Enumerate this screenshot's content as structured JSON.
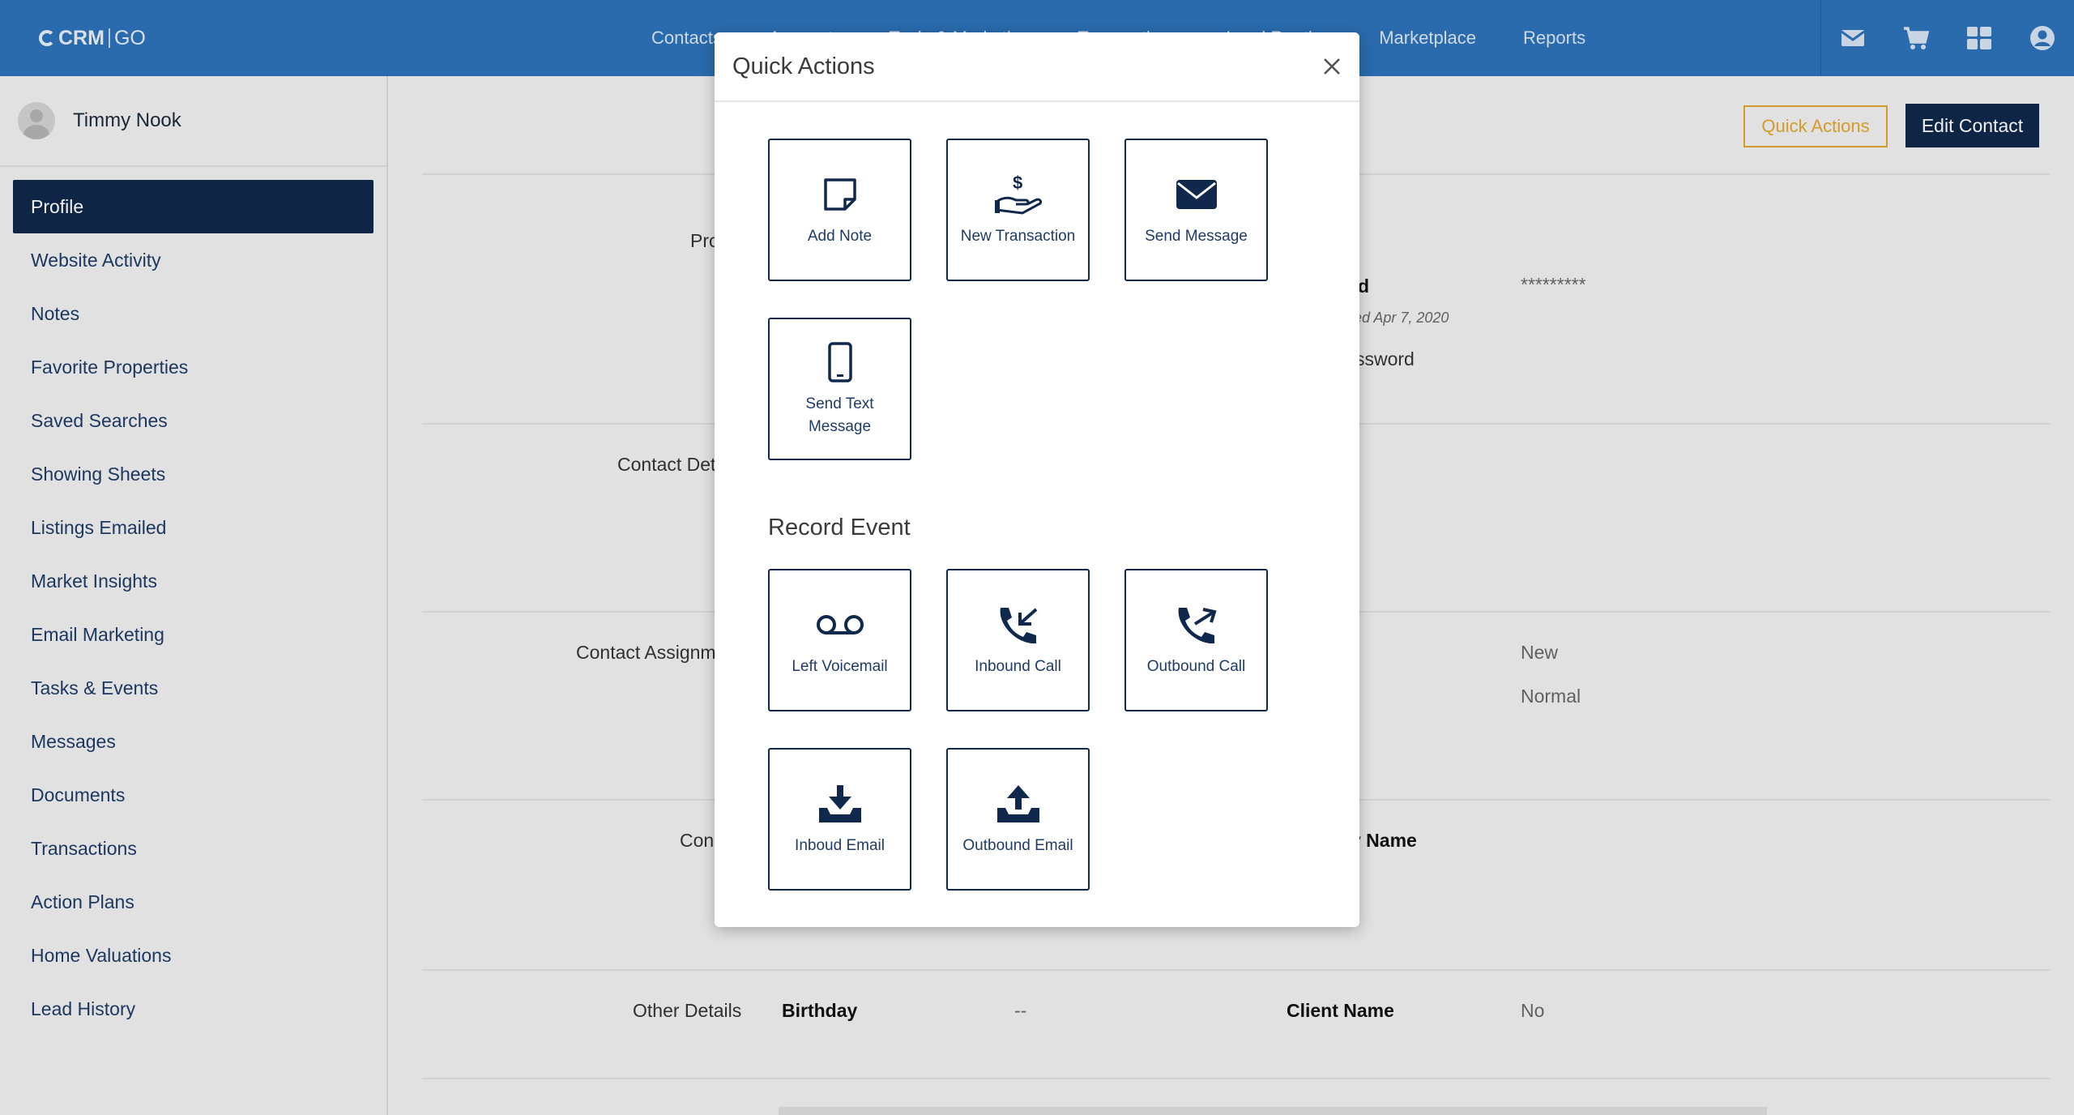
{
  "app": {
    "logo_left": "CRM",
    "logo_right": "GO"
  },
  "topnav": {
    "items": [
      "Contacts",
      "Accounts",
      "Tools & Marketing",
      "Transactions",
      "Lead Routing",
      "Marketplace",
      "Reports"
    ]
  },
  "sidebar": {
    "user_name": "Timmy Nook",
    "items": [
      {
        "label": "Profile"
      },
      {
        "label": "Website Activity"
      },
      {
        "label": "Notes"
      },
      {
        "label": "Favorite Properties"
      },
      {
        "label": "Saved Searches"
      },
      {
        "label": "Showing Sheets"
      },
      {
        "label": "Listings Emailed"
      },
      {
        "label": "Market Insights"
      },
      {
        "label": "Email Marketing"
      },
      {
        "label": "Tasks & Events"
      },
      {
        "label": "Messages"
      },
      {
        "label": "Documents"
      },
      {
        "label": "Transactions"
      },
      {
        "label": "Action Plans"
      },
      {
        "label": "Home Valuations"
      },
      {
        "label": "Lead History"
      }
    ]
  },
  "header_buttons": {
    "quick_actions": "Quick Actions",
    "edit_contact": "Edit Contact"
  },
  "profile": {
    "section_profile": "Pro",
    "password_label": "d",
    "password_value": "*********",
    "password_updated": "ed Apr 7, 2020",
    "password_link": "ssword",
    "section_contact_details": "Contact Det",
    "section_contact_assignment": "Contact Assignm",
    "status_value": "New",
    "priority_value": "Normal",
    "section_con": "Con",
    "company_name_label": "y Name",
    "section_other": "Other Details",
    "birthday_label": "Birthday",
    "birthday_value": "--",
    "client_name_label": "Client Name",
    "client_name_value": "No"
  },
  "modal": {
    "title": "Quick Actions",
    "actions": [
      {
        "label": "Add Note",
        "icon": "note-icon"
      },
      {
        "label": "New Transaction",
        "icon": "transaction-icon"
      },
      {
        "label": "Send Message",
        "icon": "envelope-icon"
      },
      {
        "label": "Send Text Message",
        "icon": "mobile-icon"
      }
    ],
    "record_title": "Record Event",
    "events": [
      {
        "label": "Left Voicemail",
        "icon": "voicemail-icon"
      },
      {
        "label": "Inbound Call",
        "icon": "inbound-call-icon"
      },
      {
        "label": "Outbound Call",
        "icon": "outbound-call-icon"
      },
      {
        "label": "Inboud Email",
        "icon": "inbox-download-icon"
      },
      {
        "label": "Outbound Email",
        "icon": "inbox-upload-icon"
      }
    ]
  },
  "colors": {
    "topbar": "#2c72b8",
    "navy": "#10284b",
    "accent": "#e3a52c"
  }
}
